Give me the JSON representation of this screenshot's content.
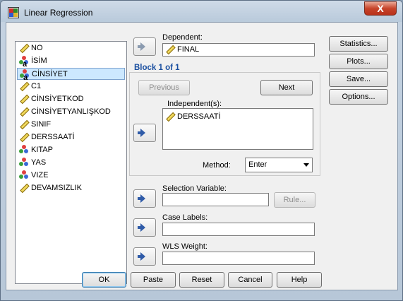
{
  "window": {
    "title": "Linear Regression",
    "close_label": "X"
  },
  "variables": [
    {
      "name": "NO",
      "type": "scale"
    },
    {
      "name": "İSİM",
      "type": "string"
    },
    {
      "name": "CİNSİYET",
      "type": "nominal-string",
      "selected": true
    },
    {
      "name": "C1",
      "type": "scale"
    },
    {
      "name": "CİNSİYETKOD",
      "type": "scale"
    },
    {
      "name": "CİNSİYETYANLIŞKOD",
      "type": "scale"
    },
    {
      "name": "SINIF",
      "type": "scale"
    },
    {
      "name": "DERSSAATİ",
      "type": "scale"
    },
    {
      "name": "KITAP",
      "type": "nominal"
    },
    {
      "name": "YAS",
      "type": "nominal"
    },
    {
      "name": "VIZE",
      "type": "nominal"
    },
    {
      "name": "DEVAMSIZLIK",
      "type": "scale"
    }
  ],
  "dependent": {
    "label": "Dependent:",
    "value": "FINAL"
  },
  "block": {
    "title": "Block 1 of 1",
    "previous_label": "Previous",
    "next_label": "Next"
  },
  "independents": {
    "label": "Independent(s):",
    "items": [
      "DERSSAATİ"
    ]
  },
  "method": {
    "label": "Method:",
    "value": "Enter"
  },
  "selection_variable": {
    "label": "Selection Variable:",
    "rule_label": "Rule..."
  },
  "case_labels": {
    "label": "Case Labels:"
  },
  "wls_weight": {
    "label": "WLS Weight:"
  },
  "side_buttons": [
    "Statistics...",
    "Plots...",
    "Save...",
    "Options..."
  ],
  "bottom_buttons": [
    "OK",
    "Paste",
    "Reset",
    "Cancel",
    "Help"
  ],
  "colors": {
    "accent": "#1a4fa0",
    "selection": "#cce8ff",
    "arrow": "#2f5ba8"
  }
}
